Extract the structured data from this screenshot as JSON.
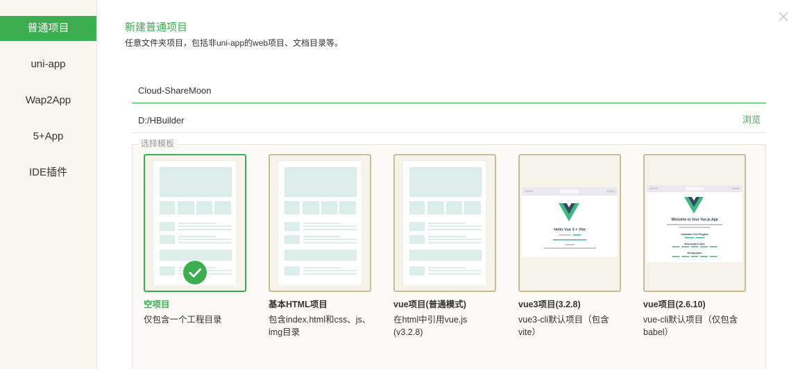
{
  "colors": {
    "accent": "#3dae50",
    "card_border": "#cbbd93",
    "wireframe": "#ddeeea",
    "vue_green": "#41b883",
    "vue_dark": "#34495e"
  },
  "dialog": {
    "close_icon": "close-icon"
  },
  "sidebar": {
    "items": [
      {
        "label": "普通项目",
        "active": true
      },
      {
        "label": "uni-app",
        "active": false
      },
      {
        "label": "Wap2App",
        "active": false
      },
      {
        "label": "5+App",
        "active": false
      },
      {
        "label": "IDE插件",
        "active": false
      }
    ]
  },
  "header": {
    "title": "新建普通项目",
    "subtitle": "任意文件夹项目，包括非uni-app的web项目、文档目录等。"
  },
  "form": {
    "project_name": "Cloud-ShareMoon",
    "location": "D:/HBuilder",
    "browse_label": "浏览"
  },
  "templates": {
    "legend": "选择模板",
    "selected_index": 0,
    "selected_icon": "checkmark-icon",
    "items": [
      {
        "name": "空项目",
        "desc_lines": [
          "仅包含一个工程目录"
        ],
        "preview": "page-wireframe"
      },
      {
        "name": "基本HTML项目",
        "desc_lines": [
          "包含index.html和css、js、",
          "img目录"
        ],
        "preview": "page-wireframe"
      },
      {
        "name": "vue项目(普通模式)",
        "desc_lines": [
          "在html中引用vue.js",
          "(v3.2.8)"
        ],
        "preview": "page-wireframe"
      },
      {
        "name": "vue3项目(3.2.8)",
        "desc_lines": [
          "vue3-cli默认项目（包含",
          "vite）"
        ],
        "preview": "vue-logo",
        "preview_heading": "Hello Vue 3 + Vite"
      },
      {
        "name": "vue项目(2.6.10)",
        "desc_lines": [
          "vue-cli默认项目（仅包含",
          "babel）"
        ],
        "preview": "vue-logo",
        "preview_heading": "Welcome to Your Vue.js App",
        "preview_sections": [
          "Installed CLI Plugins",
          "Essential Links",
          "Ecosystem"
        ]
      }
    ]
  }
}
